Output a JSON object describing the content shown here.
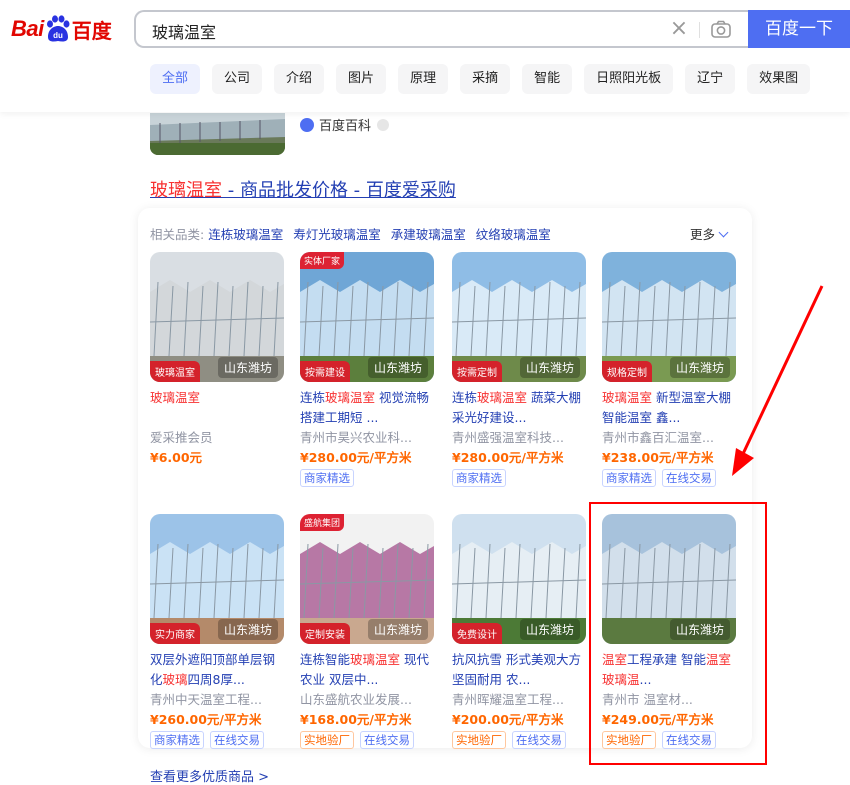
{
  "header": {
    "logo_text_left": "Bai",
    "logo_text_right": "百度",
    "logo_paw_text": "du",
    "search_value": "玻璃温室",
    "search_button": "百度一下"
  },
  "tabs": [
    "全部",
    "公司",
    "介绍",
    "图片",
    "原理",
    "采摘",
    "智能",
    "日照阳光板",
    "辽宁",
    "效果图"
  ],
  "baike": {
    "label": "百度百科"
  },
  "result": {
    "title_highlight": "玻璃温室",
    "title_rest": " - 商品批发价格 - 百度爱采购"
  },
  "related": {
    "label": "相关品类:",
    "categories": [
      "连栋玻璃温室",
      "寿灯光玻璃温室",
      "承建玻璃温室",
      "纹络玻璃温室"
    ],
    "more": "更多"
  },
  "products": [
    {
      "title_parts": [
        [
          "玻璃温室",
          true
        ]
      ],
      "shop": "爱采推会员",
      "price": "¥6.00元",
      "location": "山东潍坊",
      "tag_tl": "",
      "tag_bl": "玻璃温室",
      "badges": []
    },
    {
      "title_parts": [
        [
          "连栋",
          false
        ],
        [
          "玻璃温室",
          true
        ],
        [
          " 视觉流畅 搭建工期短 ...",
          false
        ]
      ],
      "shop": "青州市昊兴农业科...",
      "price": "¥280.00元/平方米",
      "location": "山东潍坊",
      "tag_tl": "实体厂家",
      "tag_bl": "按需建设",
      "badges": [
        [
          "商家精选",
          "blue"
        ]
      ]
    },
    {
      "title_parts": [
        [
          "连栋",
          false
        ],
        [
          "玻璃温室",
          true
        ],
        [
          " 蔬菜大棚 采光好建设...",
          false
        ]
      ],
      "shop": "青州盛强温室科技...",
      "price": "¥280.00元/平方米",
      "location": "山东潍坊",
      "tag_tl": "",
      "tag_bl": "按需定制",
      "badges": [
        [
          "商家精选",
          "blue"
        ]
      ]
    },
    {
      "title_parts": [
        [
          "玻璃温室",
          true
        ],
        [
          " 新型温室大棚 智能温室 鑫...",
          false
        ]
      ],
      "shop": "青州市鑫百汇温室...",
      "price": "¥238.00元/平方米",
      "location": "山东潍坊",
      "tag_tl": "",
      "tag_bl": "规格定制",
      "badges": [
        [
          "商家精选",
          "blue"
        ],
        [
          "在线交易",
          "blue"
        ]
      ]
    },
    {
      "title_parts": [
        [
          "双层外遮阳顶部单层钢化",
          false
        ],
        [
          "玻璃",
          true
        ],
        [
          "四周8厚...",
          false
        ]
      ],
      "shop": "青州中天温室工程...",
      "price": "¥260.00元/平方米",
      "location": "山东潍坊",
      "tag_tl": "",
      "tag_bl": "实力商家",
      "badges": [
        [
          "商家精选",
          "blue"
        ],
        [
          "在线交易",
          "blue"
        ]
      ]
    },
    {
      "title_parts": [
        [
          "连栋智能",
          false
        ],
        [
          "玻璃温室",
          true
        ],
        [
          " 现代农业 双层中...",
          false
        ]
      ],
      "shop": "山东盛航农业发展...",
      "price": "¥168.00元/平方米",
      "location": "山东潍坊",
      "tag_tl": "盛航集团",
      "tag_bl": "定制安装",
      "badges": [
        [
          "实地验厂",
          "orange"
        ],
        [
          "在线交易",
          "blue"
        ]
      ]
    },
    {
      "title_parts": [
        [
          "抗风抗雪 形式美观大方 坚固耐用 农...",
          false
        ]
      ],
      "shop": "青州晖耀温室工程...",
      "price": "¥200.00元/平方米",
      "location": "山东潍坊",
      "tag_tl": "",
      "tag_bl": "免费设计",
      "badges": [
        [
          "实地验厂",
          "orange"
        ],
        [
          "在线交易",
          "blue"
        ]
      ]
    },
    {
      "title_parts": [
        [
          "温室",
          true
        ],
        [
          "工程承建 智能",
          false
        ],
        [
          "温室 玻璃温",
          true
        ],
        [
          "...",
          false
        ]
      ],
      "shop": "青州市  温室材...",
      "price": "¥249.00元/平方米",
      "location": "山东潍坊",
      "tag_tl": "",
      "tag_bl": "",
      "badges": [
        [
          "实地验厂",
          "orange"
        ],
        [
          "在线交易",
          "blue"
        ]
      ]
    }
  ],
  "see_more": "查看更多优质商品 >",
  "colors": {
    "brand_blue": "#4e6ef2",
    "link_blue": "#2440b3",
    "highlight_red": "#f73131",
    "price_orange": "#ff6600",
    "annotation_red": "#ff0000"
  }
}
